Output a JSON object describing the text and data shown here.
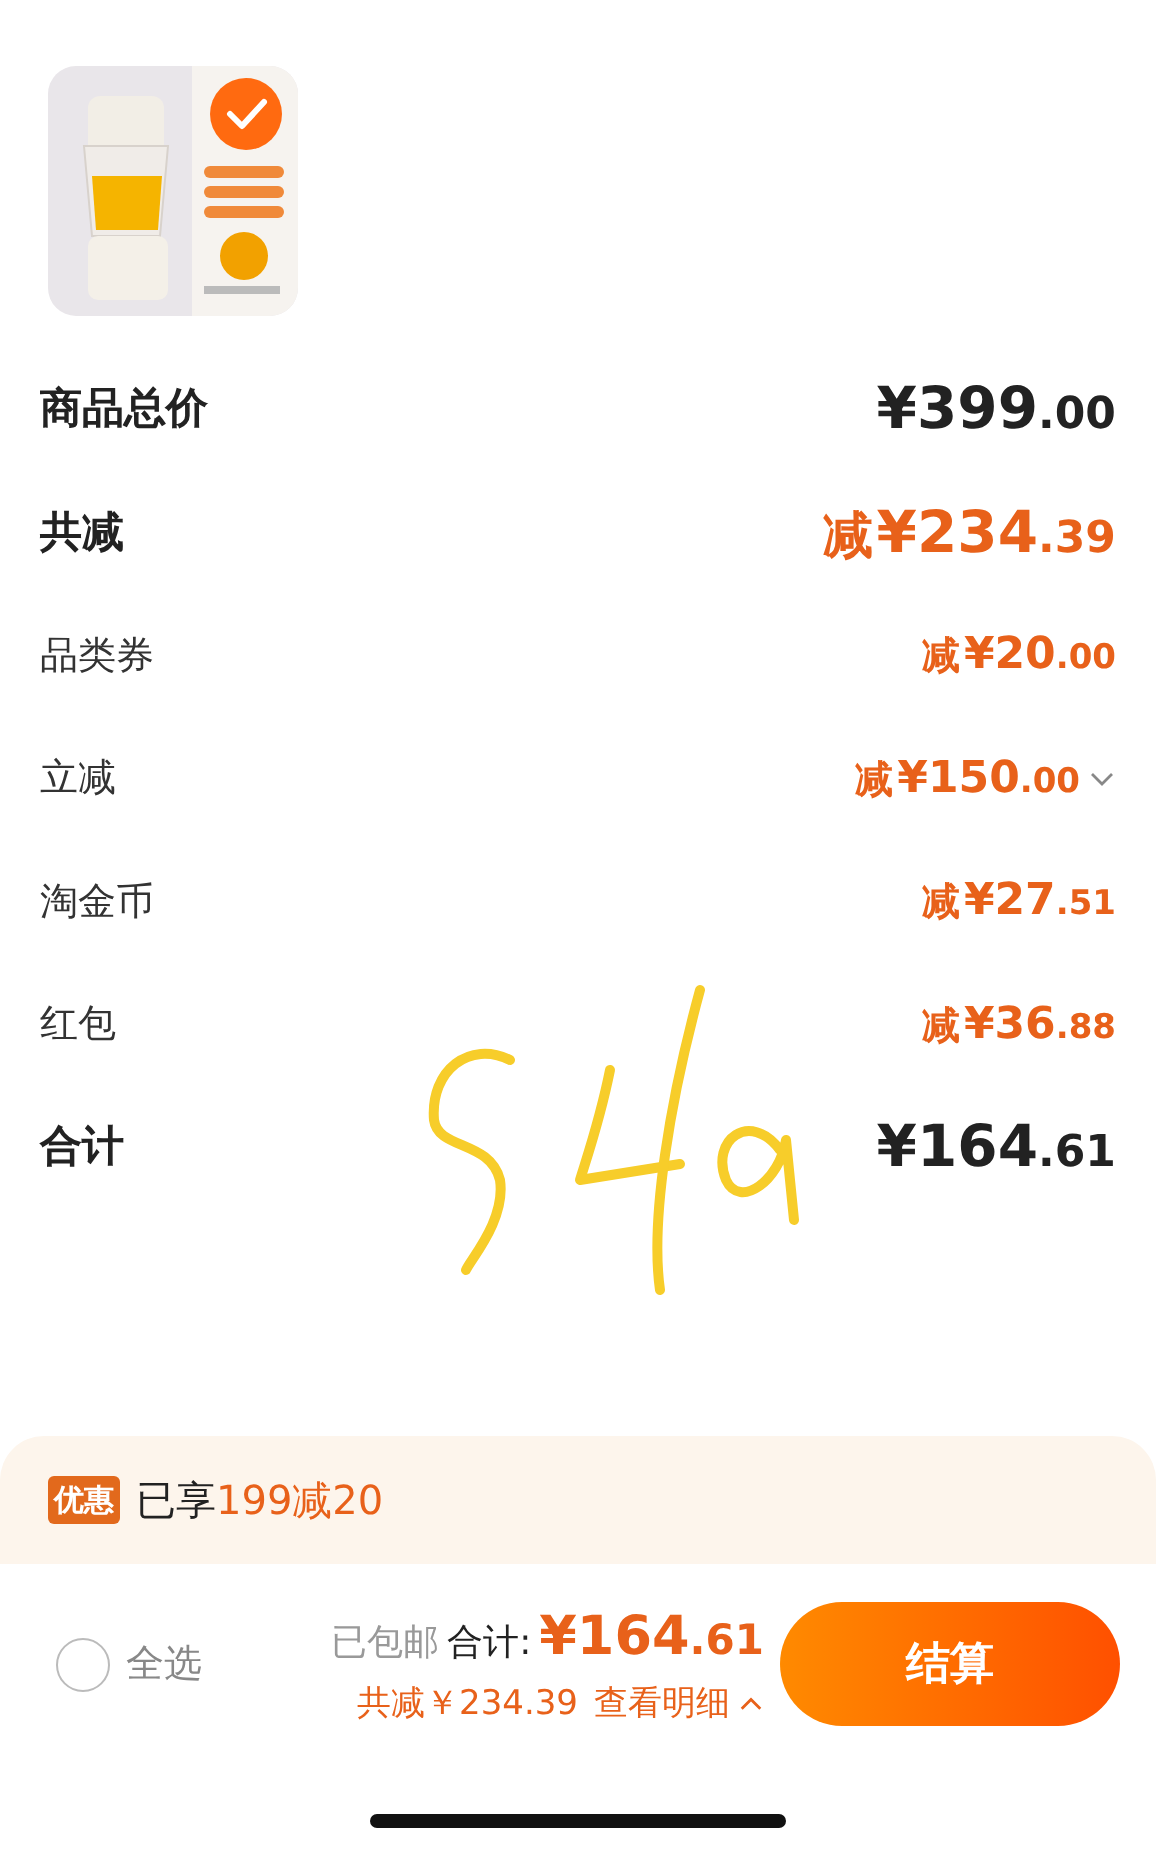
{
  "product": {
    "selected": true
  },
  "summary": [
    {
      "label": "商品总价",
      "kind": "total",
      "main": "¥399",
      "cents": ".00"
    },
    {
      "label": "共减",
      "kind": "total-discount",
      "sign": "减",
      "main": "¥234",
      "cents": ".39"
    },
    {
      "label": "品类券",
      "kind": "discount",
      "sign": "减",
      "main": "¥20",
      "cents": ".00"
    },
    {
      "label": "立减",
      "kind": "discount",
      "sign": "减",
      "main": "¥150",
      "cents": ".00",
      "expanded": false
    },
    {
      "label": "淘金币",
      "kind": "discount",
      "sign": "减",
      "main": "¥27",
      "cents": ".51"
    },
    {
      "label": "红包",
      "kind": "discount",
      "sign": "减",
      "main": "¥36",
      "cents": ".88"
    },
    {
      "label": "合计",
      "kind": "total",
      "main": "¥164",
      "cents": ".61"
    }
  ],
  "promo": {
    "badge": "优惠",
    "text": "已享",
    "highlight": "199减20"
  },
  "footer": {
    "select_all": {
      "label": "全选",
      "checked": false
    },
    "shipping": "已包邮",
    "total_label": "合计:",
    "total_main": "¥164",
    "total_cents": ".61",
    "discount": "共减￥234.39",
    "details": "查看明细",
    "details_expanded": false,
    "checkout": "结算"
  }
}
